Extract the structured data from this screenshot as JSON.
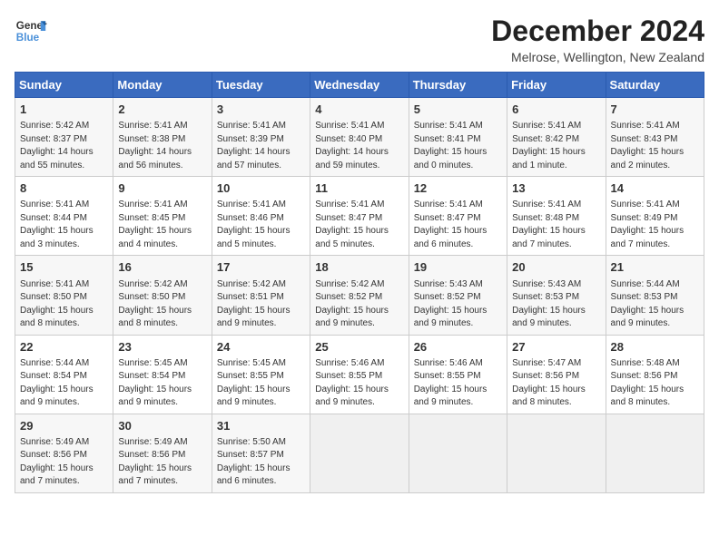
{
  "header": {
    "logo_line1": "General",
    "logo_line2": "Blue",
    "title": "December 2024",
    "subtitle": "Melrose, Wellington, New Zealand"
  },
  "weekdays": [
    "Sunday",
    "Monday",
    "Tuesday",
    "Wednesday",
    "Thursday",
    "Friday",
    "Saturday"
  ],
  "weeks": [
    [
      {
        "day": "1",
        "info": "Sunrise: 5:42 AM\nSunset: 8:37 PM\nDaylight: 14 hours\nand 55 minutes."
      },
      {
        "day": "2",
        "info": "Sunrise: 5:41 AM\nSunset: 8:38 PM\nDaylight: 14 hours\nand 56 minutes."
      },
      {
        "day": "3",
        "info": "Sunrise: 5:41 AM\nSunset: 8:39 PM\nDaylight: 14 hours\nand 57 minutes."
      },
      {
        "day": "4",
        "info": "Sunrise: 5:41 AM\nSunset: 8:40 PM\nDaylight: 14 hours\nand 59 minutes."
      },
      {
        "day": "5",
        "info": "Sunrise: 5:41 AM\nSunset: 8:41 PM\nDaylight: 15 hours\nand 0 minutes."
      },
      {
        "day": "6",
        "info": "Sunrise: 5:41 AM\nSunset: 8:42 PM\nDaylight: 15 hours\nand 1 minute."
      },
      {
        "day": "7",
        "info": "Sunrise: 5:41 AM\nSunset: 8:43 PM\nDaylight: 15 hours\nand 2 minutes."
      }
    ],
    [
      {
        "day": "8",
        "info": "Sunrise: 5:41 AM\nSunset: 8:44 PM\nDaylight: 15 hours\nand 3 minutes."
      },
      {
        "day": "9",
        "info": "Sunrise: 5:41 AM\nSunset: 8:45 PM\nDaylight: 15 hours\nand 4 minutes."
      },
      {
        "day": "10",
        "info": "Sunrise: 5:41 AM\nSunset: 8:46 PM\nDaylight: 15 hours\nand 5 minutes."
      },
      {
        "day": "11",
        "info": "Sunrise: 5:41 AM\nSunset: 8:47 PM\nDaylight: 15 hours\nand 5 minutes."
      },
      {
        "day": "12",
        "info": "Sunrise: 5:41 AM\nSunset: 8:47 PM\nDaylight: 15 hours\nand 6 minutes."
      },
      {
        "day": "13",
        "info": "Sunrise: 5:41 AM\nSunset: 8:48 PM\nDaylight: 15 hours\nand 7 minutes."
      },
      {
        "day": "14",
        "info": "Sunrise: 5:41 AM\nSunset: 8:49 PM\nDaylight: 15 hours\nand 7 minutes."
      }
    ],
    [
      {
        "day": "15",
        "info": "Sunrise: 5:41 AM\nSunset: 8:50 PM\nDaylight: 15 hours\nand 8 minutes."
      },
      {
        "day": "16",
        "info": "Sunrise: 5:42 AM\nSunset: 8:50 PM\nDaylight: 15 hours\nand 8 minutes."
      },
      {
        "day": "17",
        "info": "Sunrise: 5:42 AM\nSunset: 8:51 PM\nDaylight: 15 hours\nand 9 minutes."
      },
      {
        "day": "18",
        "info": "Sunrise: 5:42 AM\nSunset: 8:52 PM\nDaylight: 15 hours\nand 9 minutes."
      },
      {
        "day": "19",
        "info": "Sunrise: 5:43 AM\nSunset: 8:52 PM\nDaylight: 15 hours\nand 9 minutes."
      },
      {
        "day": "20",
        "info": "Sunrise: 5:43 AM\nSunset: 8:53 PM\nDaylight: 15 hours\nand 9 minutes."
      },
      {
        "day": "21",
        "info": "Sunrise: 5:44 AM\nSunset: 8:53 PM\nDaylight: 15 hours\nand 9 minutes."
      }
    ],
    [
      {
        "day": "22",
        "info": "Sunrise: 5:44 AM\nSunset: 8:54 PM\nDaylight: 15 hours\nand 9 minutes."
      },
      {
        "day": "23",
        "info": "Sunrise: 5:45 AM\nSunset: 8:54 PM\nDaylight: 15 hours\nand 9 minutes."
      },
      {
        "day": "24",
        "info": "Sunrise: 5:45 AM\nSunset: 8:55 PM\nDaylight: 15 hours\nand 9 minutes."
      },
      {
        "day": "25",
        "info": "Sunrise: 5:46 AM\nSunset: 8:55 PM\nDaylight: 15 hours\nand 9 minutes."
      },
      {
        "day": "26",
        "info": "Sunrise: 5:46 AM\nSunset: 8:55 PM\nDaylight: 15 hours\nand 9 minutes."
      },
      {
        "day": "27",
        "info": "Sunrise: 5:47 AM\nSunset: 8:56 PM\nDaylight: 15 hours\nand 8 minutes."
      },
      {
        "day": "28",
        "info": "Sunrise: 5:48 AM\nSunset: 8:56 PM\nDaylight: 15 hours\nand 8 minutes."
      }
    ],
    [
      {
        "day": "29",
        "info": "Sunrise: 5:49 AM\nSunset: 8:56 PM\nDaylight: 15 hours\nand 7 minutes."
      },
      {
        "day": "30",
        "info": "Sunrise: 5:49 AM\nSunset: 8:56 PM\nDaylight: 15 hours\nand 7 minutes."
      },
      {
        "day": "31",
        "info": "Sunrise: 5:50 AM\nSunset: 8:57 PM\nDaylight: 15 hours\nand 6 minutes."
      },
      {
        "day": "",
        "info": ""
      },
      {
        "day": "",
        "info": ""
      },
      {
        "day": "",
        "info": ""
      },
      {
        "day": "",
        "info": ""
      }
    ]
  ]
}
